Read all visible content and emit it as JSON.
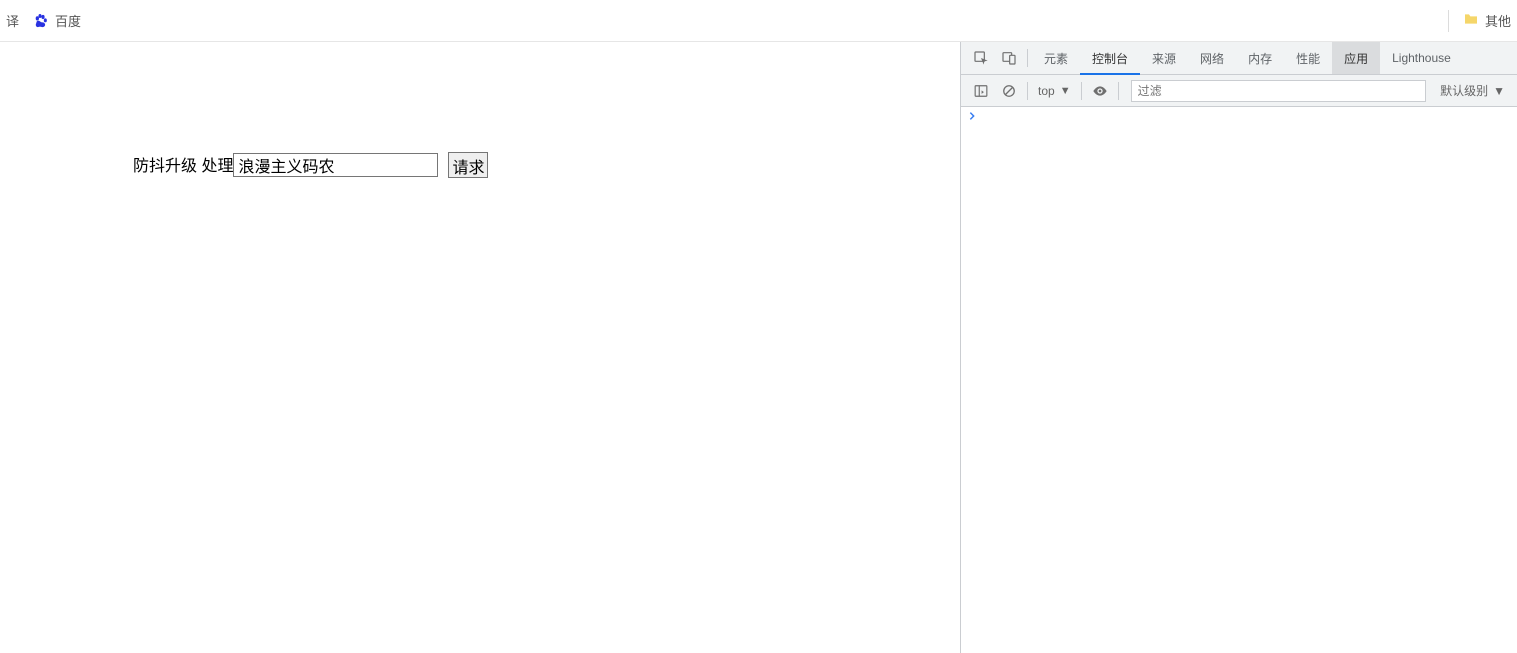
{
  "bookmark_bar": {
    "left_item_trunc": "译",
    "baidu_label": "百度",
    "right_label": "其他"
  },
  "page": {
    "label_prefix": "防抖升级 处理",
    "input_value": "浪漫主义码农",
    "button_label": "请求"
  },
  "devtools": {
    "tabs": {
      "elements": "元素",
      "console": "控制台",
      "sources": "来源",
      "network": "网络",
      "memory": "内存",
      "performance": "性能",
      "application": "应用",
      "lighthouse": "Lighthouse"
    },
    "active_tab": "console",
    "context_tab": "application",
    "toolbar": {
      "context_label": "top",
      "filter_placeholder": "过滤",
      "level_label": "默认级别"
    }
  }
}
